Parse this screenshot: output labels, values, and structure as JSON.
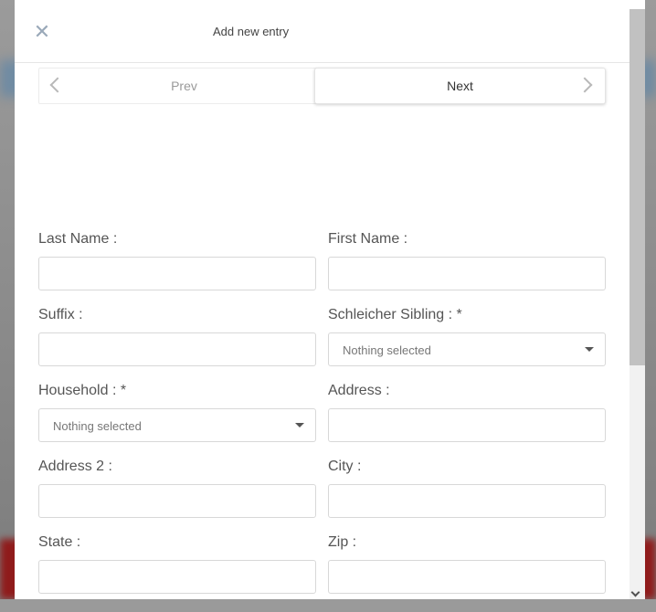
{
  "modal": {
    "close_glyph": "✕",
    "title": "Add new entry"
  },
  "pager": {
    "prev_label": "Prev",
    "next_label": "Next"
  },
  "form": {
    "last_name": {
      "label": "Last Name :",
      "value": ""
    },
    "first_name": {
      "label": "First Name :",
      "value": ""
    },
    "suffix": {
      "label": "Suffix :",
      "value": ""
    },
    "schleicher_sibling": {
      "label": "Schleicher Sibling : *",
      "selected": "Nothing selected"
    },
    "household": {
      "label": "Household : *",
      "selected": "Nothing selected"
    },
    "address": {
      "label": "Address :",
      "value": ""
    },
    "address2": {
      "label": "Address 2 :",
      "value": ""
    },
    "city": {
      "label": "City :",
      "value": ""
    },
    "state": {
      "label": "State :",
      "value": ""
    },
    "zip": {
      "label": "Zip :",
      "value": ""
    }
  },
  "icons": {
    "close": "close-icon",
    "prev": "chevron-left-icon",
    "next": "chevron-right-icon",
    "dropdown": "caret-down-icon",
    "scroll_down": "chevron-down-icon"
  }
}
